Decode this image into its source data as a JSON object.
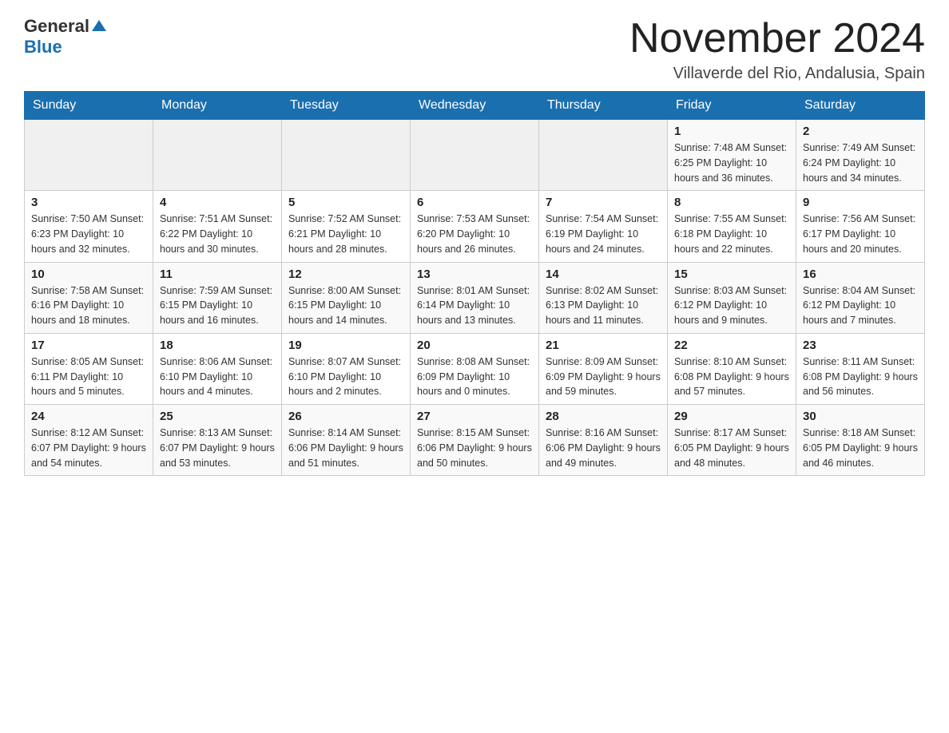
{
  "logo": {
    "general": "General",
    "blue": "Blue"
  },
  "title": "November 2024",
  "location": "Villaverde del Rio, Andalusia, Spain",
  "weekdays": [
    "Sunday",
    "Monday",
    "Tuesday",
    "Wednesday",
    "Thursday",
    "Friday",
    "Saturday"
  ],
  "weeks": [
    [
      {
        "day": "",
        "info": ""
      },
      {
        "day": "",
        "info": ""
      },
      {
        "day": "",
        "info": ""
      },
      {
        "day": "",
        "info": ""
      },
      {
        "day": "",
        "info": ""
      },
      {
        "day": "1",
        "info": "Sunrise: 7:48 AM\nSunset: 6:25 PM\nDaylight: 10 hours and 36 minutes."
      },
      {
        "day": "2",
        "info": "Sunrise: 7:49 AM\nSunset: 6:24 PM\nDaylight: 10 hours and 34 minutes."
      }
    ],
    [
      {
        "day": "3",
        "info": "Sunrise: 7:50 AM\nSunset: 6:23 PM\nDaylight: 10 hours and 32 minutes."
      },
      {
        "day": "4",
        "info": "Sunrise: 7:51 AM\nSunset: 6:22 PM\nDaylight: 10 hours and 30 minutes."
      },
      {
        "day": "5",
        "info": "Sunrise: 7:52 AM\nSunset: 6:21 PM\nDaylight: 10 hours and 28 minutes."
      },
      {
        "day": "6",
        "info": "Sunrise: 7:53 AM\nSunset: 6:20 PM\nDaylight: 10 hours and 26 minutes."
      },
      {
        "day": "7",
        "info": "Sunrise: 7:54 AM\nSunset: 6:19 PM\nDaylight: 10 hours and 24 minutes."
      },
      {
        "day": "8",
        "info": "Sunrise: 7:55 AM\nSunset: 6:18 PM\nDaylight: 10 hours and 22 minutes."
      },
      {
        "day": "9",
        "info": "Sunrise: 7:56 AM\nSunset: 6:17 PM\nDaylight: 10 hours and 20 minutes."
      }
    ],
    [
      {
        "day": "10",
        "info": "Sunrise: 7:58 AM\nSunset: 6:16 PM\nDaylight: 10 hours and 18 minutes."
      },
      {
        "day": "11",
        "info": "Sunrise: 7:59 AM\nSunset: 6:15 PM\nDaylight: 10 hours and 16 minutes."
      },
      {
        "day": "12",
        "info": "Sunrise: 8:00 AM\nSunset: 6:15 PM\nDaylight: 10 hours and 14 minutes."
      },
      {
        "day": "13",
        "info": "Sunrise: 8:01 AM\nSunset: 6:14 PM\nDaylight: 10 hours and 13 minutes."
      },
      {
        "day": "14",
        "info": "Sunrise: 8:02 AM\nSunset: 6:13 PM\nDaylight: 10 hours and 11 minutes."
      },
      {
        "day": "15",
        "info": "Sunrise: 8:03 AM\nSunset: 6:12 PM\nDaylight: 10 hours and 9 minutes."
      },
      {
        "day": "16",
        "info": "Sunrise: 8:04 AM\nSunset: 6:12 PM\nDaylight: 10 hours and 7 minutes."
      }
    ],
    [
      {
        "day": "17",
        "info": "Sunrise: 8:05 AM\nSunset: 6:11 PM\nDaylight: 10 hours and 5 minutes."
      },
      {
        "day": "18",
        "info": "Sunrise: 8:06 AM\nSunset: 6:10 PM\nDaylight: 10 hours and 4 minutes."
      },
      {
        "day": "19",
        "info": "Sunrise: 8:07 AM\nSunset: 6:10 PM\nDaylight: 10 hours and 2 minutes."
      },
      {
        "day": "20",
        "info": "Sunrise: 8:08 AM\nSunset: 6:09 PM\nDaylight: 10 hours and 0 minutes."
      },
      {
        "day": "21",
        "info": "Sunrise: 8:09 AM\nSunset: 6:09 PM\nDaylight: 9 hours and 59 minutes."
      },
      {
        "day": "22",
        "info": "Sunrise: 8:10 AM\nSunset: 6:08 PM\nDaylight: 9 hours and 57 minutes."
      },
      {
        "day": "23",
        "info": "Sunrise: 8:11 AM\nSunset: 6:08 PM\nDaylight: 9 hours and 56 minutes."
      }
    ],
    [
      {
        "day": "24",
        "info": "Sunrise: 8:12 AM\nSunset: 6:07 PM\nDaylight: 9 hours and 54 minutes."
      },
      {
        "day": "25",
        "info": "Sunrise: 8:13 AM\nSunset: 6:07 PM\nDaylight: 9 hours and 53 minutes."
      },
      {
        "day": "26",
        "info": "Sunrise: 8:14 AM\nSunset: 6:06 PM\nDaylight: 9 hours and 51 minutes."
      },
      {
        "day": "27",
        "info": "Sunrise: 8:15 AM\nSunset: 6:06 PM\nDaylight: 9 hours and 50 minutes."
      },
      {
        "day": "28",
        "info": "Sunrise: 8:16 AM\nSunset: 6:06 PM\nDaylight: 9 hours and 49 minutes."
      },
      {
        "day": "29",
        "info": "Sunrise: 8:17 AM\nSunset: 6:05 PM\nDaylight: 9 hours and 48 minutes."
      },
      {
        "day": "30",
        "info": "Sunrise: 8:18 AM\nSunset: 6:05 PM\nDaylight: 9 hours and 46 minutes."
      }
    ]
  ]
}
